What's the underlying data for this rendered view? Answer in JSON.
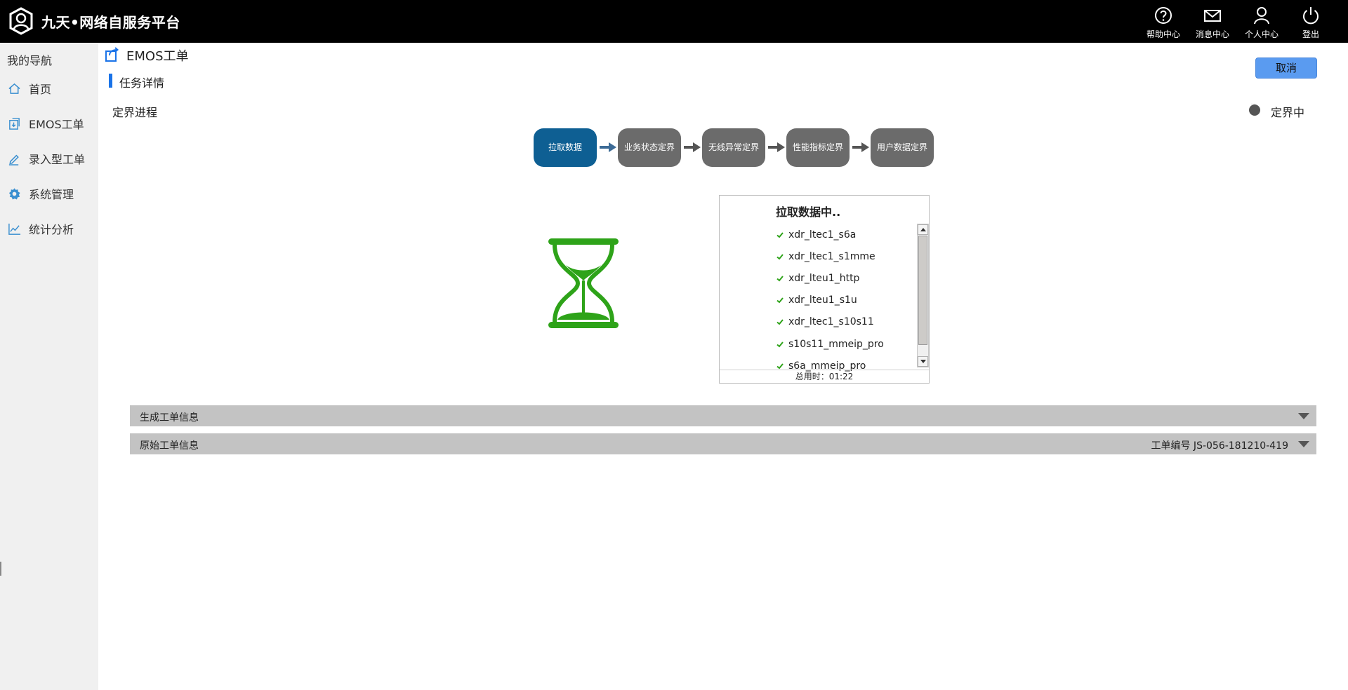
{
  "app": {
    "title": "九天•网络自服务平台",
    "logo_icon": "user-shield-logo"
  },
  "header": {
    "actions": [
      {
        "label": "帮助中心",
        "icon": "help-icon"
      },
      {
        "label": "消息中心",
        "icon": "mail-icon"
      },
      {
        "label": "个人中心",
        "icon": "user-icon"
      },
      {
        "label": "登出",
        "icon": "power-icon"
      }
    ]
  },
  "sidebar": {
    "heading": "我的导航",
    "items": [
      {
        "label": "首页",
        "icon": "home-icon"
      },
      {
        "label": "EMOS工单",
        "icon": "document-arrow-icon"
      },
      {
        "label": "录入型工单",
        "icon": "pen-icon"
      },
      {
        "label": "系统管理",
        "icon": "gear-icon"
      },
      {
        "label": "统计分析",
        "icon": "line-chart-icon"
      }
    ]
  },
  "page": {
    "title": "EMOS工单",
    "section_title": "任务详情",
    "cancel_label": "取消",
    "progress_label": "定界进程",
    "status_text": "定界中"
  },
  "steps": [
    {
      "label": "拉取数据",
      "active": true
    },
    {
      "label": "业务状态定界",
      "active": false
    },
    {
      "label": "无线异常定界",
      "active": false
    },
    {
      "label": "性能指标定界",
      "active": false
    },
    {
      "label": "用户数据定界",
      "active": false
    }
  ],
  "log_panel": {
    "title": "拉取数据中..",
    "items": [
      "xdr_ltec1_s6a",
      "xdr_ltec1_s1mme",
      "xdr_lteu1_http",
      "xdr_lteu1_s1u",
      "xdr_ltec1_s10s11",
      "s10s11_mmeip_pro",
      "s6a_mmeip_pro"
    ],
    "footer": "总用时：01:22"
  },
  "panels": {
    "generated": {
      "label": "生成工单信息"
    },
    "original": {
      "label": "原始工单信息",
      "meta": "工单编号 JS-056-181210-419"
    }
  },
  "colors": {
    "topbar": "#000000",
    "sidebar": "#f0f0f0",
    "active_step": "#0e5f93",
    "inactive_step": "#6b6b6b",
    "hourglass": "#2ea319",
    "accent": "#1a73e8",
    "cancel_button": "#5a9bf0",
    "nav_icon": "#3a8fd0"
  }
}
